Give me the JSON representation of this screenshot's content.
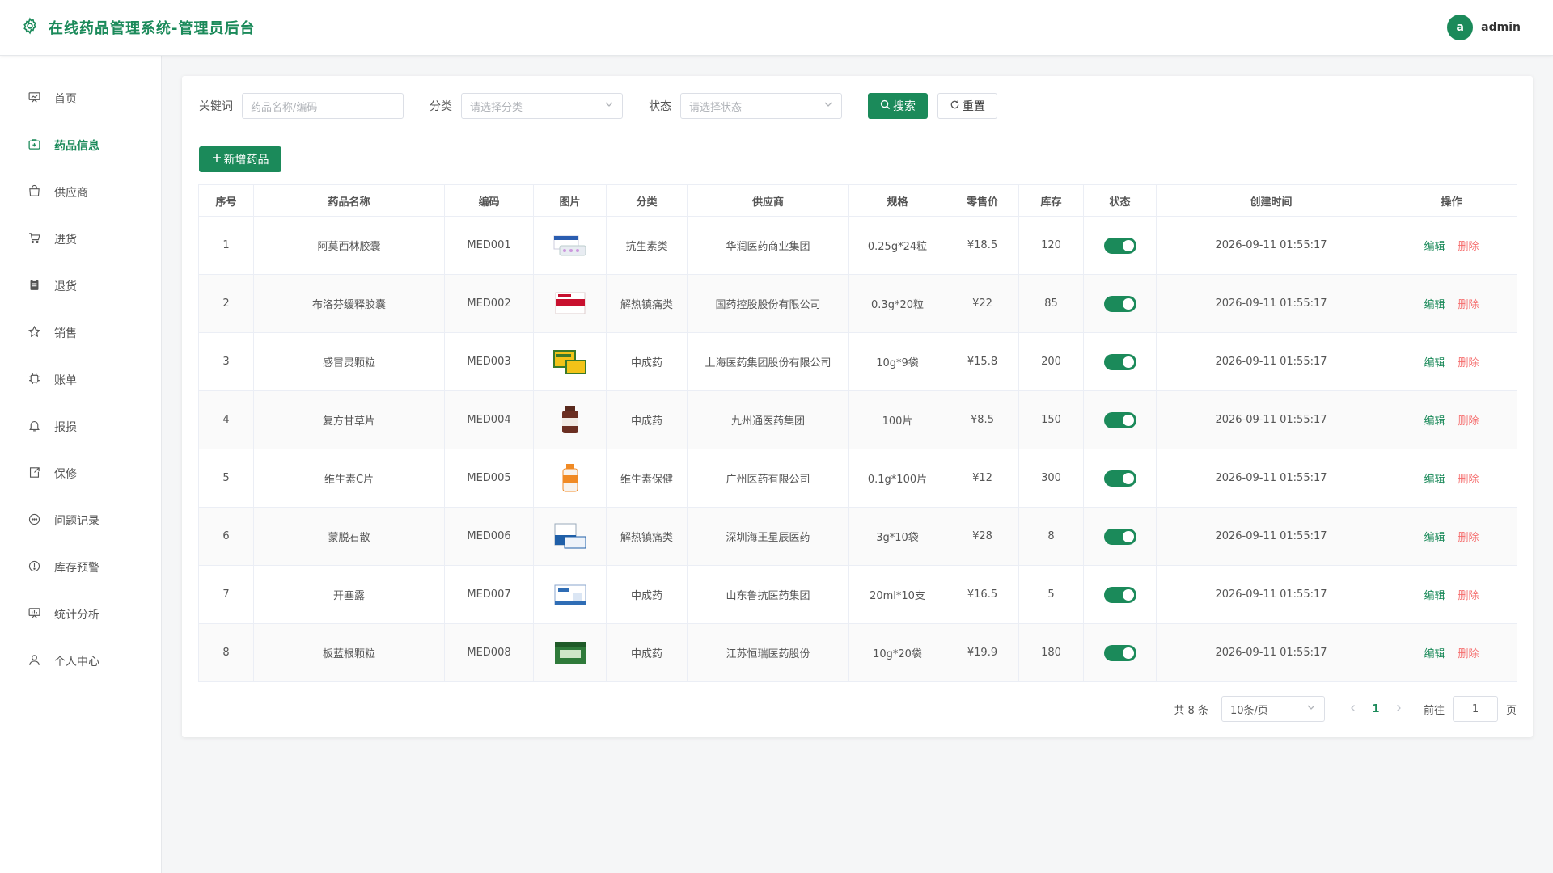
{
  "app": {
    "title": "在线药品管理系统-管理员后台",
    "brand_color": "#1b8a5a",
    "user": {
      "avatar_letter": "a",
      "name": "admin"
    }
  },
  "sidebar": {
    "items": [
      {
        "label": "首页",
        "icon": "home-board-icon",
        "active": false
      },
      {
        "label": "药品信息",
        "icon": "medicine-kit-icon",
        "active": true
      },
      {
        "label": "供应商",
        "icon": "shopping-bag-icon",
        "active": false
      },
      {
        "label": "进货",
        "icon": "cart-icon",
        "active": false
      },
      {
        "label": "退货",
        "icon": "clipboard-icon",
        "active": false
      },
      {
        "label": "销售",
        "icon": "star-icon",
        "active": false
      },
      {
        "label": "账单",
        "icon": "chip-icon",
        "active": false
      },
      {
        "label": "报损",
        "icon": "bell-icon",
        "active": false
      },
      {
        "label": "保修",
        "icon": "external-box-icon",
        "active": false
      },
      {
        "label": "问题记录",
        "icon": "chat-icon",
        "active": false
      },
      {
        "label": "库存预警",
        "icon": "warning-circle-icon",
        "active": false
      },
      {
        "label": "统计分析",
        "icon": "chart-board-icon",
        "active": false
      },
      {
        "label": "个人中心",
        "icon": "user-icon",
        "active": false
      }
    ]
  },
  "filters": {
    "keyword_label": "关键词",
    "keyword_placeholder": "药品名称/编码",
    "keyword_value": "",
    "category_label": "分类",
    "category_placeholder": "请选择分类",
    "status_label": "状态",
    "status_placeholder": "请选择状态",
    "search_button": "搜索",
    "reset_button": "重置"
  },
  "actions": {
    "add_button": "新增药品"
  },
  "table": {
    "headers": [
      "序号",
      "药品名称",
      "编码",
      "图片",
      "分类",
      "供应商",
      "规格",
      "零售价",
      "库存",
      "状态",
      "创建时间",
      "操作"
    ],
    "edit_label": "编辑",
    "delete_label": "删除",
    "rows": [
      {
        "no": "1",
        "name": "阿莫西林胶囊",
        "code": "MED001",
        "image": "blue-white-pill-box",
        "category": "抗生素类",
        "supplier": "华润医药商业集团",
        "spec": "0.25g*24粒",
        "price": "¥18.5",
        "stock": "120",
        "enabled": true,
        "created": "2026-09-11 01:55:17"
      },
      {
        "no": "2",
        "name": "布洛芬缓释胶囊",
        "code": "MED002",
        "image": "red-white-box",
        "category": "解热镇痛类",
        "supplier": "国药控股股份有限公司",
        "spec": "0.3g*20粒",
        "price": "¥22",
        "stock": "85",
        "enabled": true,
        "created": "2026-09-11 01:55:17"
      },
      {
        "no": "3",
        "name": "感冒灵颗粒",
        "code": "MED003",
        "image": "yellow-green-boxes",
        "category": "中成药",
        "supplier": "上海医药集团股份有限公司",
        "spec": "10g*9袋",
        "price": "¥15.8",
        "stock": "200",
        "enabled": true,
        "created": "2026-09-11 01:55:17"
      },
      {
        "no": "4",
        "name": "复方甘草片",
        "code": "MED004",
        "image": "brown-bottle",
        "category": "中成药",
        "supplier": "九州通医药集团",
        "spec": "100片",
        "price": "¥8.5",
        "stock": "150",
        "enabled": true,
        "created": "2026-09-11 01:55:17"
      },
      {
        "no": "5",
        "name": "维生素C片",
        "code": "MED005",
        "image": "orange-bottle",
        "category": "维生素保健",
        "supplier": "广州医药有限公司",
        "spec": "0.1g*100片",
        "price": "¥12",
        "stock": "300",
        "enabled": true,
        "created": "2026-09-11 01:55:17"
      },
      {
        "no": "6",
        "name": "蒙脱石散",
        "code": "MED006",
        "image": "blue-sachet-box",
        "category": "解热镇痛类",
        "supplier": "深圳海王星辰医药",
        "spec": "3g*10袋",
        "price": "¥28",
        "stock": "8",
        "enabled": true,
        "created": "2026-09-11 01:55:17"
      },
      {
        "no": "7",
        "name": "开塞露",
        "code": "MED007",
        "image": "white-blue-box",
        "category": "中成药",
        "supplier": "山东鲁抗医药集团",
        "spec": "20ml*10支",
        "price": "¥16.5",
        "stock": "5",
        "enabled": true,
        "created": "2026-09-11 01:55:17"
      },
      {
        "no": "8",
        "name": "板蓝根颗粒",
        "code": "MED008",
        "image": "green-box",
        "category": "中成药",
        "supplier": "江苏恒瑞医药股份",
        "spec": "10g*20袋",
        "price": "¥19.9",
        "stock": "180",
        "enabled": true,
        "created": "2026-09-11 01:55:17"
      }
    ]
  },
  "pagination": {
    "total_text": "共 8 条",
    "page_size": "10条/页",
    "current_page": "1",
    "goto_label": "前往",
    "goto_value": "1",
    "page_suffix": "页"
  }
}
